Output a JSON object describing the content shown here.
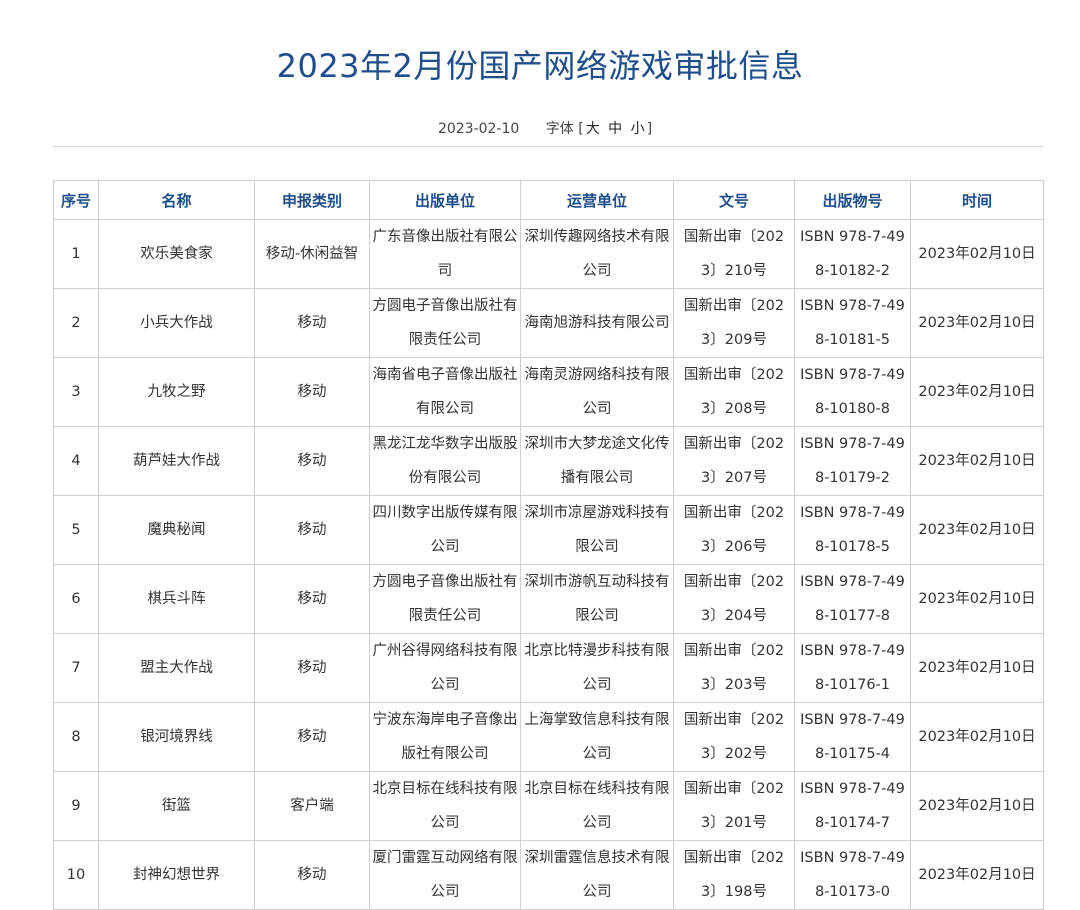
{
  "title": "2023年2月份国产网络游戏审批信息",
  "meta": {
    "date": "2023-02-10",
    "font_label": "字体",
    "bracket_open": "[",
    "font_large": "大",
    "font_medium": "中",
    "font_small": "小",
    "bracket_close": "]"
  },
  "table": {
    "headers": [
      "序号",
      "名称",
      "申报类别",
      "出版单位",
      "运营单位",
      "文号",
      "出版物号",
      "时间"
    ],
    "rows": [
      {
        "idx": "1",
        "name": "欢乐美食家",
        "type": "移动-休闲益智",
        "publisher": "广东音像出版社有限公司",
        "operator": "深圳传趣网络技术有限公司",
        "doc": "国新出审〔2023〕210号",
        "isbn": "ISBN 978-7-498-10182-2",
        "time": "2023年02月10日"
      },
      {
        "idx": "2",
        "name": "小兵大作战",
        "type": "移动",
        "publisher": "方圆电子音像出版社有限责任公司",
        "operator": "海南旭游科技有限公司",
        "doc": "国新出审〔2023〕209号",
        "isbn": "ISBN 978-7-498-10181-5",
        "time": "2023年02月10日"
      },
      {
        "idx": "3",
        "name": "九牧之野",
        "type": "移动",
        "publisher": "海南省电子音像出版社有限公司",
        "operator": "海南灵游网络科技有限公司",
        "doc": "国新出审〔2023〕208号",
        "isbn": "ISBN 978-7-498-10180-8",
        "time": "2023年02月10日"
      },
      {
        "idx": "4",
        "name": "葫芦娃大作战",
        "type": "移动",
        "publisher": "黑龙江龙华数字出版股份有限公司",
        "operator": "深圳市大梦龙途文化传播有限公司",
        "doc": "国新出审〔2023〕207号",
        "isbn": "ISBN 978-7-498-10179-2",
        "time": "2023年02月10日"
      },
      {
        "idx": "5",
        "name": "魔典秘闻",
        "type": "移动",
        "publisher": "四川数字出版传媒有限公司",
        "operator": "深圳市凉屋游戏科技有限公司",
        "doc": "国新出审〔2023〕206号",
        "isbn": "ISBN 978-7-498-10178-5",
        "time": "2023年02月10日"
      },
      {
        "idx": "6",
        "name": "棋兵斗阵",
        "type": "移动",
        "publisher": "方圆电子音像出版社有限责任公司",
        "operator": "深圳市游帆互动科技有限公司",
        "doc": "国新出审〔2023〕204号",
        "isbn": "ISBN 978-7-498-10177-8",
        "time": "2023年02月10日"
      },
      {
        "idx": "7",
        "name": "盟主大作战",
        "type": "移动",
        "publisher": "广州谷得网络科技有限公司",
        "operator": "北京比特漫步科技有限公司",
        "doc": "国新出审〔2023〕203号",
        "isbn": "ISBN 978-7-498-10176-1",
        "time": "2023年02月10日"
      },
      {
        "idx": "8",
        "name": "银河境界线",
        "type": "移动",
        "publisher": "宁波东海岸电子音像出版社有限公司",
        "operator": "上海掌致信息科技有限公司",
        "doc": "国新出审〔2023〕202号",
        "isbn": "ISBN 978-7-498-10175-4",
        "time": "2023年02月10日"
      },
      {
        "idx": "9",
        "name": "街篮",
        "type": "客户端",
        "publisher": "北京目标在线科技有限公司",
        "operator": "北京目标在线科技有限公司",
        "doc": "国新出审〔2023〕201号",
        "isbn": "ISBN 978-7-498-10174-7",
        "time": "2023年02月10日"
      },
      {
        "idx": "10",
        "name": "封神幻想世界",
        "type": "移动",
        "publisher": "厦门雷霆互动网络有限公司",
        "operator": "深圳雷霆信息技术有限公司",
        "doc": "国新出审〔2023〕198号",
        "isbn": "ISBN 978-7-498-10173-0",
        "time": "2023年02月10日"
      }
    ]
  }
}
